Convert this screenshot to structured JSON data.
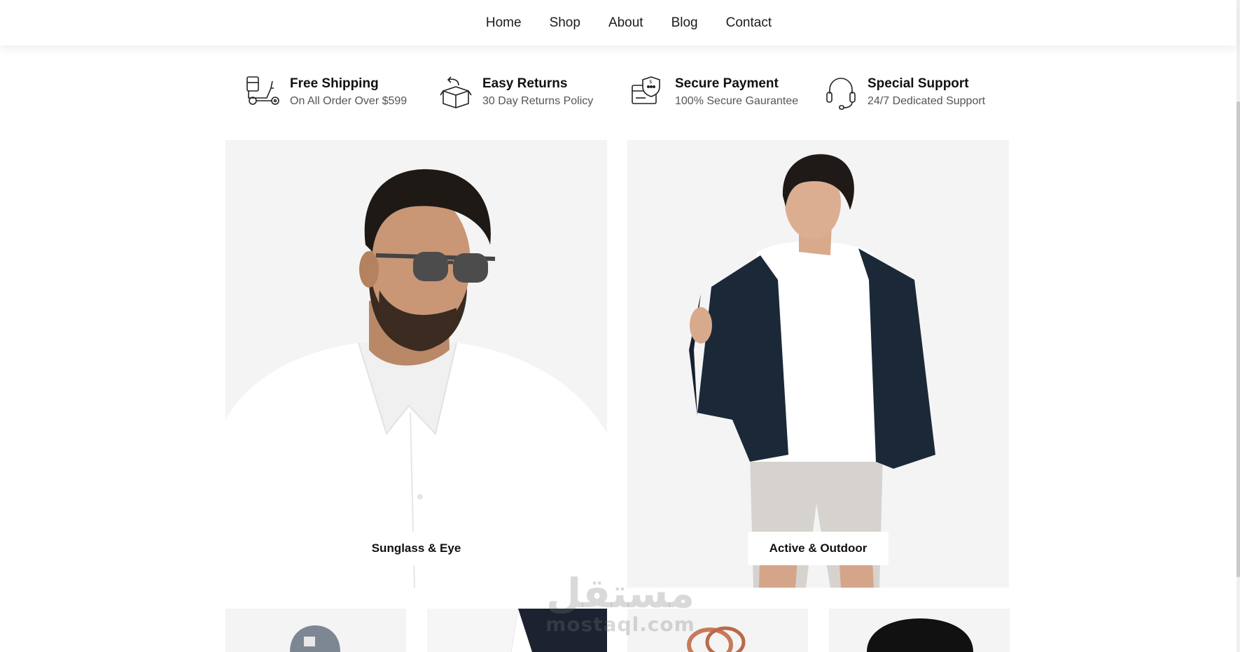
{
  "nav": {
    "items": [
      {
        "label": "Home"
      },
      {
        "label": "Shop"
      },
      {
        "label": "About"
      },
      {
        "label": "Blog"
      },
      {
        "label": "Contact"
      }
    ]
  },
  "features": [
    {
      "icon": "delivery-scooter-icon",
      "title": "Free Shipping",
      "subtitle": "On All Order Over $599"
    },
    {
      "icon": "returns-box-icon",
      "title": "Easy Returns",
      "subtitle": "30 Day Returns Policy"
    },
    {
      "icon": "secure-payment-card-icon",
      "title": "Secure Payment",
      "subtitle": "100% Secure Gaurantee"
    },
    {
      "icon": "headset-support-icon",
      "title": "Special Support",
      "subtitle": "24/7 Dedicated Support"
    }
  ],
  "banners": [
    {
      "label": "Sunglass & Eye"
    },
    {
      "label": "Active & Outdoor"
    }
  ],
  "watermark": {
    "arabic": "مستقل",
    "latin": "mostaql.com"
  },
  "colors": {
    "background": "#ffffff",
    "panel": "#f4f4f4",
    "text": "#111111",
    "muted": "#555555"
  }
}
